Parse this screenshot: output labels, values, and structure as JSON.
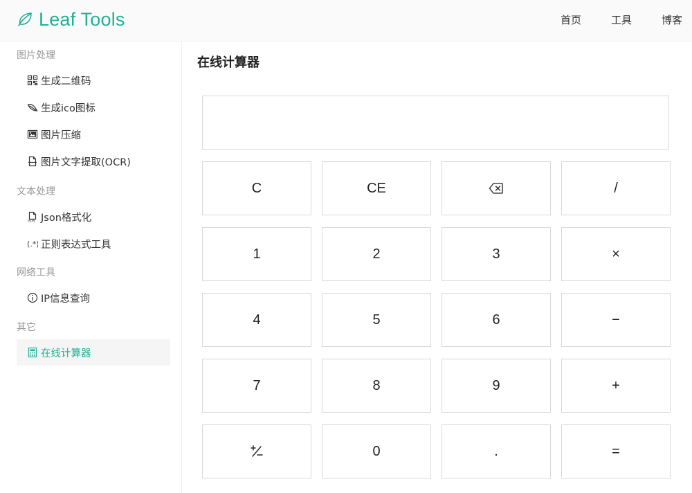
{
  "header": {
    "brand": "Leaf Tools",
    "brand_color": "#1fb196",
    "logo_icon": "leaf-icon",
    "nav": [
      {
        "label": "首页"
      },
      {
        "label": "工具"
      },
      {
        "label": "博客"
      }
    ]
  },
  "sidebar": {
    "groups": [
      {
        "title": "图片处理",
        "items": [
          {
            "label": "生成二维码",
            "icon": "qrcode-icon"
          },
          {
            "label": "生成ico图标",
            "icon": "leaf-outline-icon"
          },
          {
            "label": "图片压缩",
            "icon": "picture-icon"
          },
          {
            "label": "图片文字提取(OCR)",
            "icon": "file-icon"
          }
        ]
      },
      {
        "title": "文本处理",
        "items": [
          {
            "label": "Json格式化",
            "icon": "json-file-icon"
          },
          {
            "label": "正则表达式工具",
            "icon": "regex-icon"
          }
        ]
      },
      {
        "title": "网络工具",
        "items": [
          {
            "label": "IP信息查询",
            "icon": "info-circle-icon"
          }
        ]
      },
      {
        "title": "其它",
        "items": [
          {
            "label": "在线计算器",
            "icon": "calculator-icon",
            "active": true
          }
        ]
      }
    ]
  },
  "main": {
    "title": "在线计算器",
    "display_value": "",
    "keys": [
      [
        "C",
        "CE",
        "⌫",
        "/"
      ],
      [
        "1",
        "2",
        "3",
        "×"
      ],
      [
        "4",
        "5",
        "6",
        "−"
      ],
      [
        "7",
        "8",
        "9",
        "+"
      ],
      [
        "+/−",
        "0",
        ".",
        "="
      ]
    ]
  }
}
